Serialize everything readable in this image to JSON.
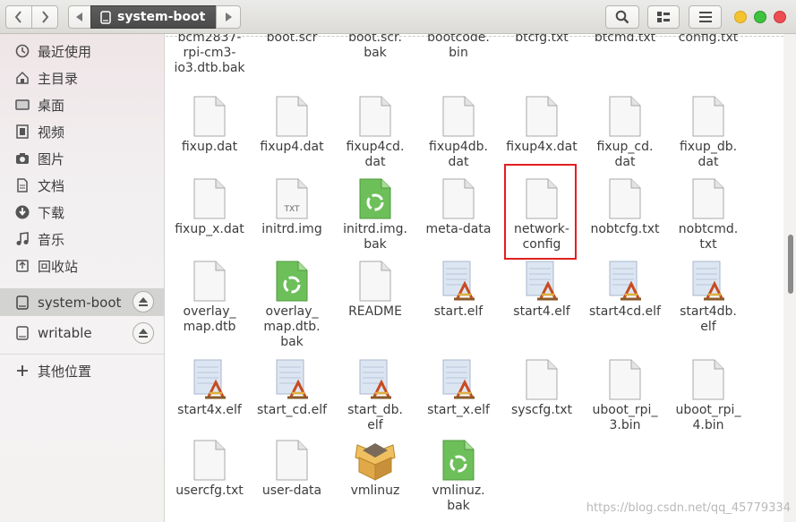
{
  "header": {
    "location": "system-boot"
  },
  "sidebar": {
    "items": [
      {
        "label": "最近使用",
        "icon": "clock-icon"
      },
      {
        "label": "主目录",
        "icon": "home-icon"
      },
      {
        "label": "桌面",
        "icon": "desktop-icon"
      },
      {
        "label": "视频",
        "icon": "video-icon"
      },
      {
        "label": "图片",
        "icon": "camera-icon"
      },
      {
        "label": "文档",
        "icon": "document-icon"
      },
      {
        "label": "下载",
        "icon": "download-icon"
      },
      {
        "label": "音乐",
        "icon": "music-icon"
      },
      {
        "label": "回收站",
        "icon": "trash-icon"
      }
    ],
    "devices": [
      {
        "label": "system-boot",
        "icon": "drive-icon"
      },
      {
        "label": "writable",
        "icon": "drive-icon"
      }
    ],
    "other": {
      "label": "其他位置",
      "icon": "plus-icon"
    }
  },
  "files": [
    {
      "name": "bcm2837-rpi-cm3-io3.dtb.bak",
      "display": "bcm2837-\nrpi-cm3-\nio3.dtb.bak",
      "type": "cut"
    },
    {
      "name": "boot.scr",
      "display": "boot.scr",
      "type": "cut"
    },
    {
      "name": "boot.scr.bak",
      "display": "boot.scr.\nbak",
      "type": "cut"
    },
    {
      "name": "bootcode.bin",
      "display": "bootcode.\nbin",
      "type": "cut"
    },
    {
      "name": "btcfg.txt",
      "display": "btcfg.txt",
      "type": "cut"
    },
    {
      "name": "btcmd.txt",
      "display": "btcmd.txt",
      "type": "cut"
    },
    {
      "name": "config.txt",
      "display": "config.txt",
      "type": "cut"
    },
    {
      "name": "fixup.dat",
      "display": "fixup.dat",
      "type": "doc"
    },
    {
      "name": "fixup4.dat",
      "display": "fixup4.dat",
      "type": "doc"
    },
    {
      "name": "fixup4cd.dat",
      "display": "fixup4cd.\ndat",
      "type": "doc"
    },
    {
      "name": "fixup4db.dat",
      "display": "fixup4db.\ndat",
      "type": "doc"
    },
    {
      "name": "fixup4x.dat",
      "display": "fixup4x.dat",
      "type": "doc"
    },
    {
      "name": "fixup_cd.dat",
      "display": "fixup_cd.\ndat",
      "type": "doc"
    },
    {
      "name": "fixup_db.dat",
      "display": "fixup_db.\ndat",
      "type": "doc"
    },
    {
      "name": "fixup_x.dat",
      "display": "fixup_x.dat",
      "type": "doc"
    },
    {
      "name": "initrd.img",
      "display": "initrd.img",
      "type": "txt"
    },
    {
      "name": "initrd.img.bak",
      "display": "initrd.img.\nbak",
      "type": "recycle"
    },
    {
      "name": "meta-data",
      "display": "meta-data",
      "type": "doc"
    },
    {
      "name": "network-config",
      "display": "network-\nconfig",
      "type": "doc"
    },
    {
      "name": "nobtcfg.txt",
      "display": "nobtcfg.txt",
      "type": "doc"
    },
    {
      "name": "nobtcmd.txt",
      "display": "nobtcmd.\ntxt",
      "type": "doc"
    },
    {
      "name": "overlay_map.dtb",
      "display": "overlay_\nmap.dtb",
      "type": "doc"
    },
    {
      "name": "overlay_map.dtb.bak",
      "display": "overlay_\nmap.dtb.\nbak",
      "type": "recycle"
    },
    {
      "name": "README",
      "display": "README",
      "type": "doc"
    },
    {
      "name": "start.elf",
      "display": "start.elf",
      "type": "elf"
    },
    {
      "name": "start4.elf",
      "display": "start4.elf",
      "type": "elf"
    },
    {
      "name": "start4cd.elf",
      "display": "start4cd.elf",
      "type": "elf"
    },
    {
      "name": "start4db.elf",
      "display": "start4db.\nelf",
      "type": "elf"
    },
    {
      "name": "start4x.elf",
      "display": "start4x.elf",
      "type": "elf"
    },
    {
      "name": "start_cd.elf",
      "display": "start_cd.elf",
      "type": "elf"
    },
    {
      "name": "start_db.elf",
      "display": "start_db.\nelf",
      "type": "elf"
    },
    {
      "name": "start_x.elf",
      "display": "start_x.elf",
      "type": "elf"
    },
    {
      "name": "syscfg.txt",
      "display": "syscfg.txt",
      "type": "doc"
    },
    {
      "name": "uboot_rpi_3.bin",
      "display": "uboot_rpi_\n3.bin",
      "type": "doc"
    },
    {
      "name": "uboot_rpi_4.bin",
      "display": "uboot_rpi_\n4.bin",
      "type": "doc"
    },
    {
      "name": "usercfg.txt",
      "display": "usercfg.txt",
      "type": "doc"
    },
    {
      "name": "user-data",
      "display": "user-data",
      "type": "doc"
    },
    {
      "name": "vmlinuz",
      "display": "vmlinuz",
      "type": "package"
    },
    {
      "name": "vmlinuz.bak",
      "display": "vmlinuz.\nbak",
      "type": "recycle"
    }
  ],
  "selected_file": "network-config",
  "icon_labels": {
    "txt_badge": "TXT"
  },
  "watermark": "https://blog.csdn.net/qq_45779334",
  "colors": {
    "highlight": "#e0201e",
    "active_sidebar": "#d3d3d1",
    "path_current": "#4f4f4f"
  }
}
